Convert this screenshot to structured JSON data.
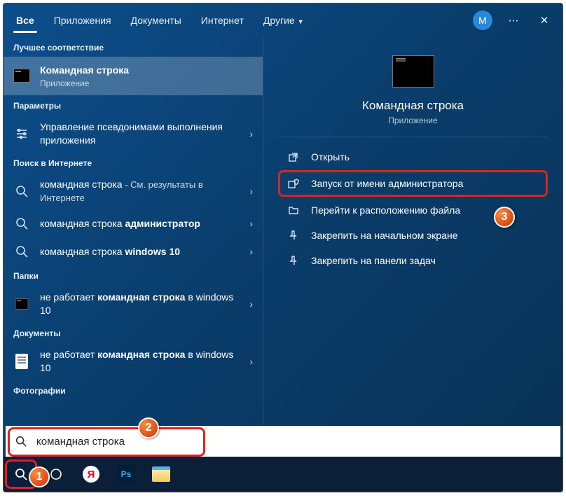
{
  "header": {
    "tabs": [
      "Все",
      "Приложения",
      "Документы",
      "Интернет",
      "Другие"
    ],
    "avatar_letter": "М"
  },
  "left": {
    "best_label": "Лучшее соответствие",
    "best": {
      "title": "Командная строка",
      "sub": "Приложение"
    },
    "params_label": "Параметры",
    "params": {
      "title": "Управление псевдонимами выполнения приложения"
    },
    "web_label": "Поиск в Интернете",
    "web1": {
      "title": "командная строка",
      "suffix": " - См. результаты в Интернете"
    },
    "web2": {
      "pre": "командная строка ",
      "bold": "администратор"
    },
    "web3": {
      "pre": "командная строка ",
      "bold": "windows 10"
    },
    "folders_label": "Папки",
    "folder1": {
      "pre": "не работает ",
      "bold": "командная строка",
      "post": " в windows 10"
    },
    "docs_label": "Документы",
    "doc1": {
      "pre": "не работает ",
      "bold": "командная строка",
      "post": " в windows 10"
    },
    "photos_label": "Фотографии"
  },
  "preview": {
    "title": "Командная строка",
    "sub": "Приложение",
    "actions": {
      "open": "Открыть",
      "admin": "Запуск от имени администратора",
      "location": "Перейти к расположению файла",
      "pin_start": "Закрепить на начальном экране",
      "pin_task": "Закрепить на панели задач"
    }
  },
  "search": {
    "value": "командная строка"
  },
  "bubbles": {
    "b1": "1",
    "b2": "2",
    "b3": "3"
  }
}
